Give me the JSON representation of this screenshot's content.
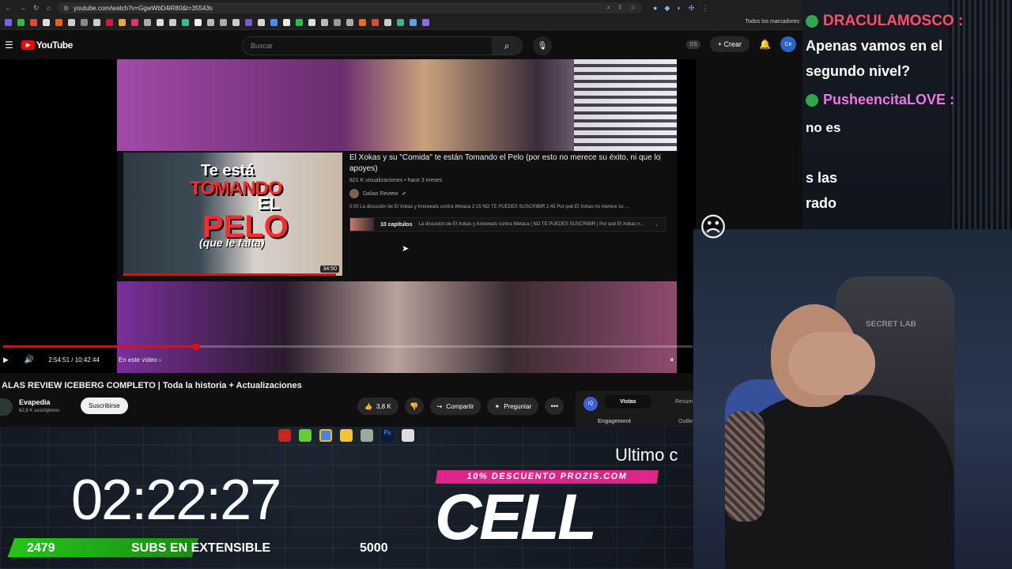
{
  "browser": {
    "url": "youtube.com/watch?v=GgwWbD4iR80&t=35543s",
    "bookmarks_label": "Todos los marcadores"
  },
  "youtube": {
    "logo_text": "YouTube",
    "search_placeholder": "Buscar",
    "account_pill": "SS",
    "create_label": "Crear",
    "avatar_label": "Ce"
  },
  "card": {
    "title": "El Xokas y su \"Comida\" te están Tomando el Pelo (por esto no merece su éxito, ni que lo apoyes)",
    "meta": "821 K visualizaciones • hace 3 meses",
    "channel": "Dalias Review",
    "description": "0:00 La discusión de El Xokas y Knoweats contra Wetaca 2:15 NO TE PUEDES SUSCRIBIR 2:45 Por qué El Xokas no merece su ...",
    "chapters_count": "10 capítulos",
    "chapters_text": "La discusión de El Xokas y Knoweats contra Wetaca | NO TE PUEDES SUSCRIBIR | Por qué El Xokas n...",
    "thumb": {
      "line1": "Te está",
      "line2": "TOMANDO",
      "line3": "EL",
      "line4": "PELO",
      "line5": "(que le falta)",
      "duration": "34:50",
      "watched_fraction": 0.97
    }
  },
  "player": {
    "time": "2:54:51 / 10:42:44",
    "in_this_video": "En este vídeo",
    "progress_fraction": 0.28
  },
  "video": {
    "title": "ALAS REVIEW ICEBERG COMPLETO | Toda la historia + Actualizaciones",
    "channel_name": "Evapedia",
    "subscribers": "62,9 K suscriptores",
    "subscribe_label": "Suscribirse",
    "likes": "3,8 K",
    "share_label": "Compartir",
    "ask_label": "Preguntar"
  },
  "panel": {
    "iq": "IQ",
    "tab_views": "Vistas",
    "tab_summary": "Resum",
    "engagement": "Engagement",
    "outlier": "Outlie"
  },
  "chat": {
    "user1": "DRACULAMOSCO",
    "msg1_line1": "Apenas vamos en el",
    "msg1_line2": "segundo nivel?",
    "user2": "PusheencitaLOVE",
    "msg2": "no es",
    "msg3": "s las",
    "msg4": "rado"
  },
  "cam": {
    "chair_brand": "SECRET LAB"
  },
  "overlay": {
    "ultimo": "Ultimo c",
    "timer": "02:22:27",
    "promo": "10% DESCUENTO PROZIS.COM",
    "cell": "CELL",
    "subs_current": "2479",
    "subs_label": "SUBS EN EXTENSIBLE",
    "subs_goal": "5000"
  },
  "colors": {
    "youtube_red": "#ff0000",
    "promo_pink": "#e0258a",
    "subs_green": "#24c51a",
    "chat_user1": "#ff4f6a",
    "chat_user2": "#e978e5"
  }
}
